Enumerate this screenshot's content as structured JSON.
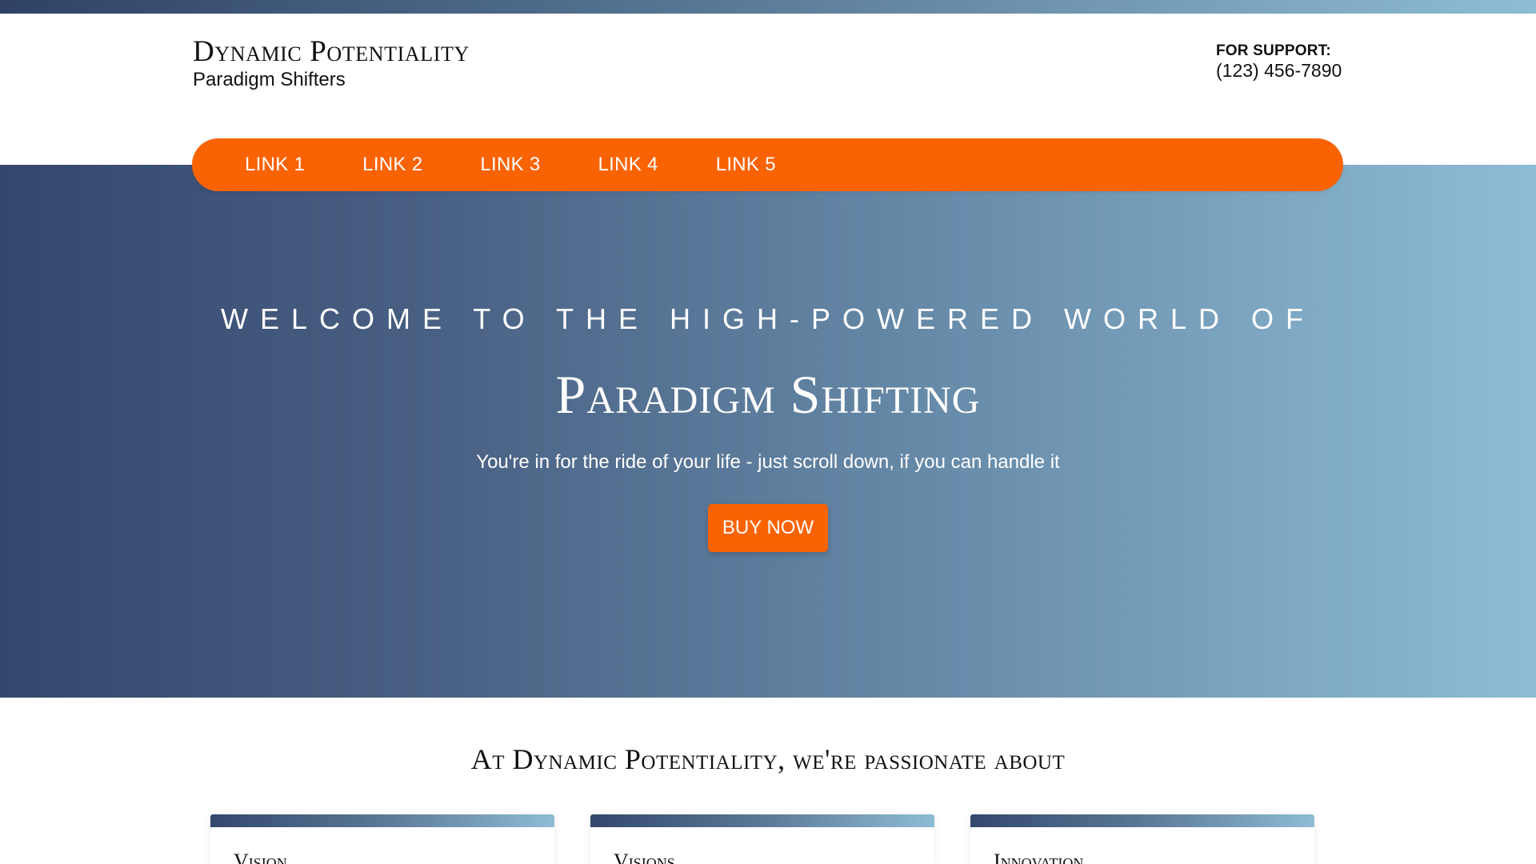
{
  "header": {
    "brand_title": "Dynamic Potentiality",
    "brand_subtitle": "Paradigm Shifters",
    "support_label": "FOR SUPPORT:",
    "support_phone": "(123) 456-7890"
  },
  "nav": {
    "links": [
      "LINK 1",
      "LINK 2",
      "LINK 3",
      "LINK 4",
      "LINK 5"
    ]
  },
  "hero": {
    "kicker": "WELCOME TO THE HIGH-POWERED WORLD OF",
    "title": "Paradigm Shifting",
    "subtitle": "You're in for the ride of your life - just scroll down, if you can handle it",
    "cta_label": "BUY NOW"
  },
  "passion": {
    "heading": "At Dynamic Potentiality, we're passionate about",
    "cards": [
      {
        "title": "Vision"
      },
      {
        "title": "Visions"
      },
      {
        "title": "Innovation"
      }
    ]
  },
  "colors": {
    "accent": "#fa6304",
    "gradient_start": "#33476c",
    "gradient_end": "#8ebcd5",
    "text": "#111111"
  }
}
